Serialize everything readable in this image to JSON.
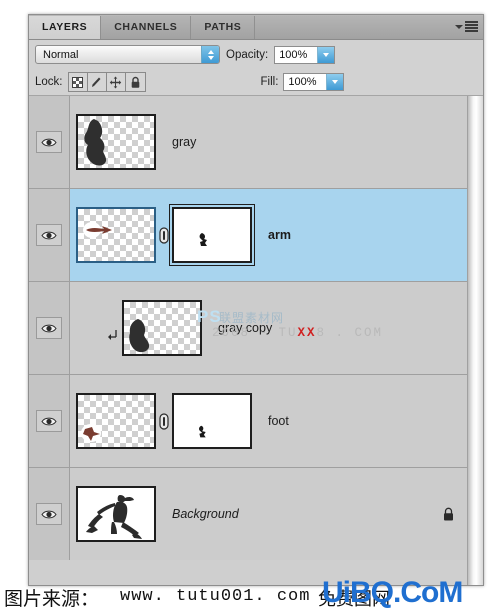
{
  "panel": {
    "tabs": [
      {
        "label": "LAYERS",
        "active": true
      },
      {
        "label": "CHANNELS",
        "active": false
      },
      {
        "label": "PATHS",
        "active": false
      }
    ],
    "menu_icon": "panel-menu-icon"
  },
  "options": {
    "blend_mode": "Normal",
    "opacity_label": "Opacity:",
    "opacity_value": "100%",
    "fill_label": "Fill:",
    "fill_value": "100%",
    "lock_label": "Lock:",
    "lock_buttons": [
      "lock-transparent-pixels-icon",
      "lock-image-pixels-icon",
      "lock-position-icon",
      "lock-all-icon"
    ]
  },
  "layers": [
    {
      "name": "gray",
      "visible": true,
      "selected": false,
      "bold": false,
      "italic": false,
      "has_mask": false,
      "linked": false,
      "clipped": false,
      "locked": false,
      "thumb_type": "transparent"
    },
    {
      "name": "arm",
      "visible": true,
      "selected": true,
      "bold": true,
      "italic": false,
      "has_mask": true,
      "linked": true,
      "clipped": false,
      "locked": false,
      "thumb_type": "transparent"
    },
    {
      "name": "gray copy",
      "visible": true,
      "selected": false,
      "bold": false,
      "italic": false,
      "has_mask": false,
      "linked": false,
      "clipped": true,
      "locked": false,
      "thumb_type": "transparent"
    },
    {
      "name": "foot",
      "visible": true,
      "selected": false,
      "bold": false,
      "italic": false,
      "has_mask": true,
      "linked": true,
      "clipped": false,
      "locked": false,
      "thumb_type": "transparent"
    },
    {
      "name": "Background",
      "visible": true,
      "selected": false,
      "bold": false,
      "italic": true,
      "has_mask": false,
      "linked": false,
      "clipped": false,
      "locked": true,
      "thumb_type": "photo"
    }
  ],
  "watermarks": {
    "ps_mark": "PS",
    "cn_mark": "联盟素材网",
    "domain_mark_left": "2008 - TU",
    "domain_mark_xx": "XX",
    "domain_mark_right": "8 . COM"
  },
  "caption": {
    "source_label": "图片来源：",
    "url": "www. tutu001. com",
    "site_cn": "免费图网",
    "watermark": "UiBQ.CoM"
  },
  "colors": {
    "panel_bg": "#d2d2d2",
    "row_bg": "#cccccc",
    "row_selected": "#a8d4ee",
    "accent_blue": "#3f9ad4",
    "watermark_blue": "#1f6fd0",
    "text": "#1c1c1c"
  }
}
